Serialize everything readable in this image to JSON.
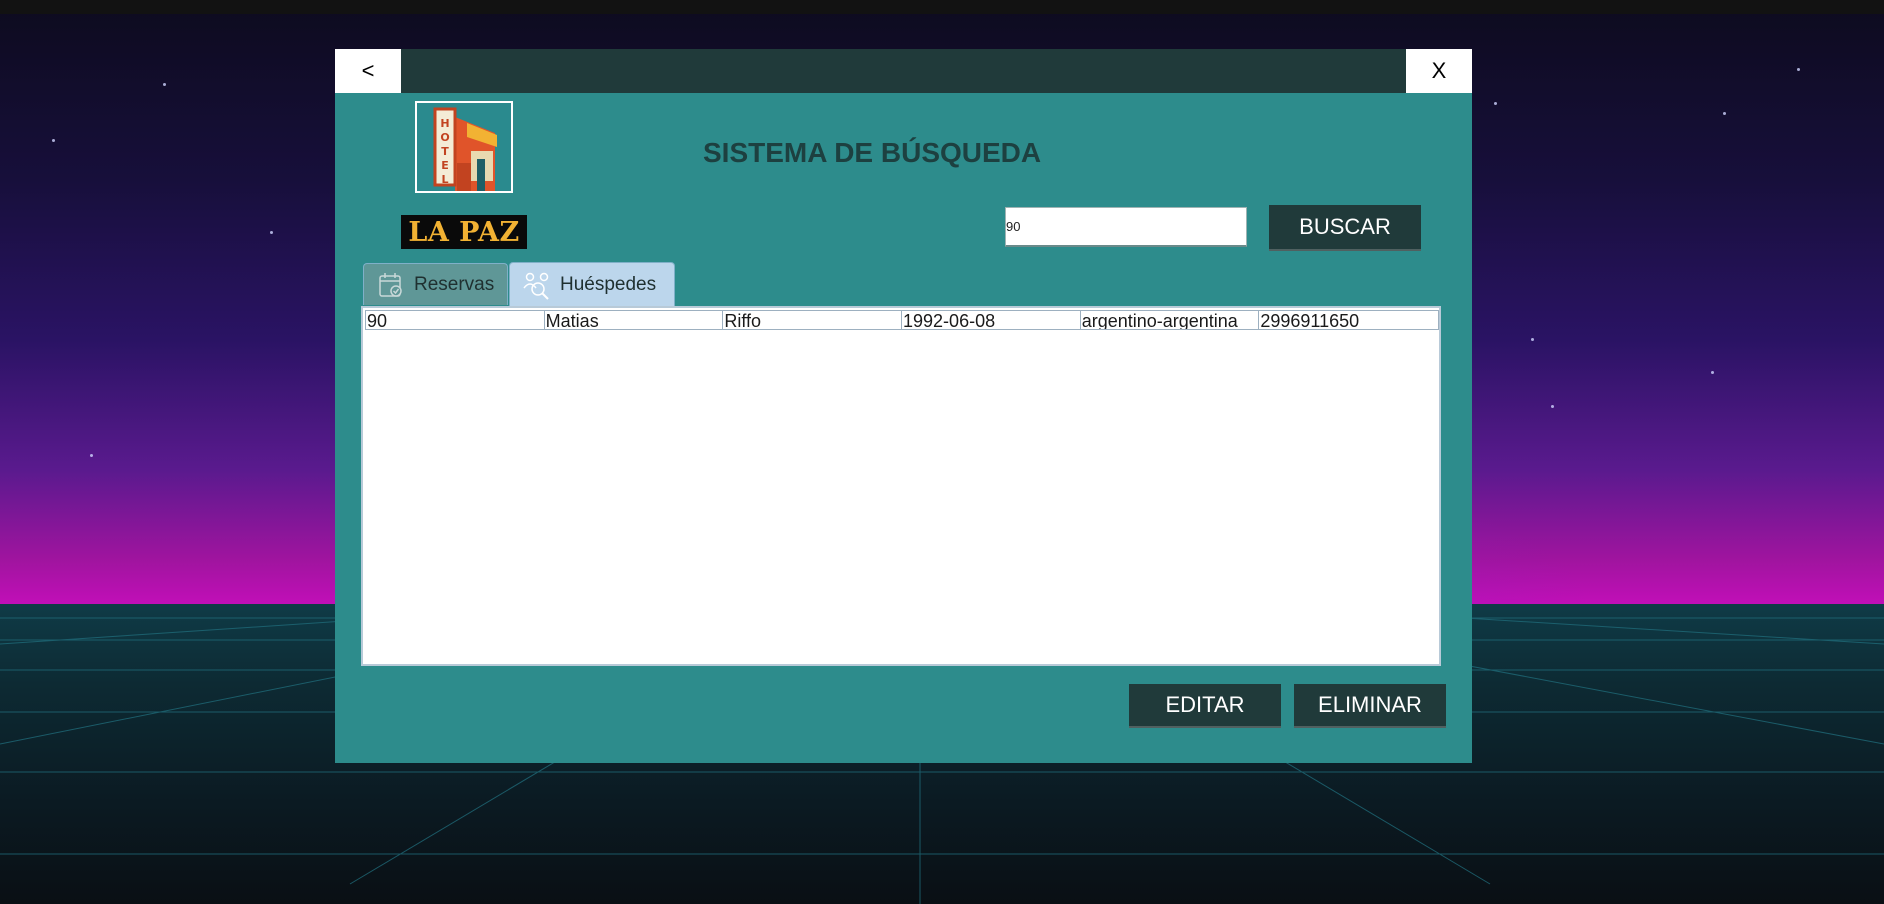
{
  "window": {
    "back_label": "<",
    "close_label": "X"
  },
  "logo": {
    "sign_text": "HOTEL",
    "name": "LA PAZ"
  },
  "title": "SISTEMA DE BÚSQUEDA",
  "search": {
    "value": "90",
    "button_label": "BUSCAR"
  },
  "tabs": [
    {
      "label": "Reservas",
      "icon": "calendar-check-icon",
      "selected": false
    },
    {
      "label": "Huéspedes",
      "icon": "guests-search-icon",
      "selected": true
    }
  ],
  "table": {
    "rows": [
      [
        "90",
        "Matias",
        "Riffo",
        "1992-06-08",
        "argentino-argentina",
        "2996911650"
      ]
    ]
  },
  "actions": {
    "edit_label": "EDITAR",
    "delete_label": "ELIMINAR"
  },
  "colors": {
    "window_bg": "#2d8c8c",
    "titlebar_bg": "#203a3a",
    "button_bg": "#203a3a",
    "tab_selected_bg": "#bcd6ec"
  }
}
